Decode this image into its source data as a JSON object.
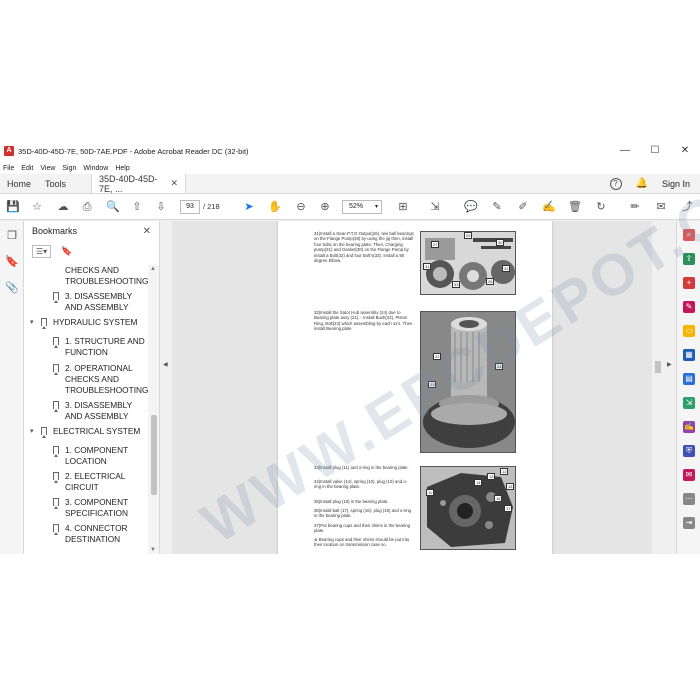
{
  "window": {
    "app_icon_letter": "A",
    "title": "35D-40D-45D-7E, 50D-7AE.PDF - Adobe Acrobat Reader DC (32-bit)",
    "minimize": "—",
    "maximize": "☐",
    "close": "✕"
  },
  "menu": [
    "File",
    "Edit",
    "View",
    "Sign",
    "Window",
    "Help"
  ],
  "tabs": {
    "home": "Home",
    "tools": "Tools",
    "document": "35D-40D-45D-7E, ...",
    "close": "✕",
    "help_icon": "?",
    "sign_in": "Sign In"
  },
  "toolbar": {
    "page_current": "93",
    "page_total": "/ 218",
    "zoom": "52%",
    "zoom_arrow": "▾"
  },
  "bookmarks": {
    "title": "Bookmarks",
    "close": "✕",
    "options_label": "☰▾",
    "collapsed_arrow": "▾",
    "items": [
      {
        "label1": "CHECKS AND",
        "label2": "TROUBLESHOOTING",
        "level": 2,
        "partial": true
      },
      {
        "label1": "3. DISASSEMBLY",
        "label2": "AND ASSEMBLY",
        "level": 2
      },
      {
        "label1": "HYDRAULIC SYSTEM",
        "label2": "",
        "level": 1
      },
      {
        "label1": "1. STRUCTURE AND",
        "label2": "FUNCTION",
        "level": 2
      },
      {
        "label1": "2. OPERATIONAL",
        "label2": "CHECKS AND",
        "label3": "TROUBLESHOOTING",
        "level": 2
      },
      {
        "label1": "3. DISASSEMBLY",
        "label2": "AND ASSEMBLY",
        "level": 2
      },
      {
        "label1": "ELECTRICAL SYSTEM",
        "label2": "",
        "level": 1
      },
      {
        "label1": "1. COMPONENT",
        "label2": "LOCATION",
        "level": 2
      },
      {
        "label1": "2. ELECTRICAL",
        "label2": "CIRCUIT",
        "level": 2
      },
      {
        "label1": "3. COMPONENT",
        "label2": "SPECIFICATION",
        "level": 2
      },
      {
        "label1": "4. CONNECTOR",
        "label2": "DESTINATION",
        "level": 2
      }
    ]
  },
  "document": {
    "steps": [
      "31)Install a Gear-P.T.O Output(26), two ball bearings on the Flange Pump(28) by using the jig then, install four bolts on the bearing plate. Then, Charging pump(31) and Gasket(30) on the Flange Pump by install a Bolt(32) and four Bolt's(33). Install a 90 degree Elbow.",
      "32)Install the Sator Hub assembly (24) due to Bearing plate assy (21). - Install Bush(22), Piston Ring, Bolt(23) which assembling by each ox's. Then install Bearing plate",
      "33)Install plug (11) and o-ring in the bearing plate.",
      "34)Install valve (14), spring (10), plug (10) and o-ring in the bearing plate.",
      "35)Install plug (19) in the bearing plate.",
      "36)Install ball (17), spring (16), plug (16) and o-ring in the bearing plate.",
      "37)Put bearing cups and their shims in the bearing plate.",
      "※ Bearing cups and their shims should be put into their location on transmission case so"
    ],
    "callouts_photo1": [
      "29",
      "27",
      "30",
      "31",
      "33",
      "26",
      "32"
    ],
    "callouts_photo2": [
      "22",
      "24",
      "23"
    ],
    "callouts_photo3": [
      "12",
      "13",
      "14",
      "15",
      "16",
      "17",
      "11"
    ],
    "watermark": "WWW.EPCDEPOT.COM"
  }
}
